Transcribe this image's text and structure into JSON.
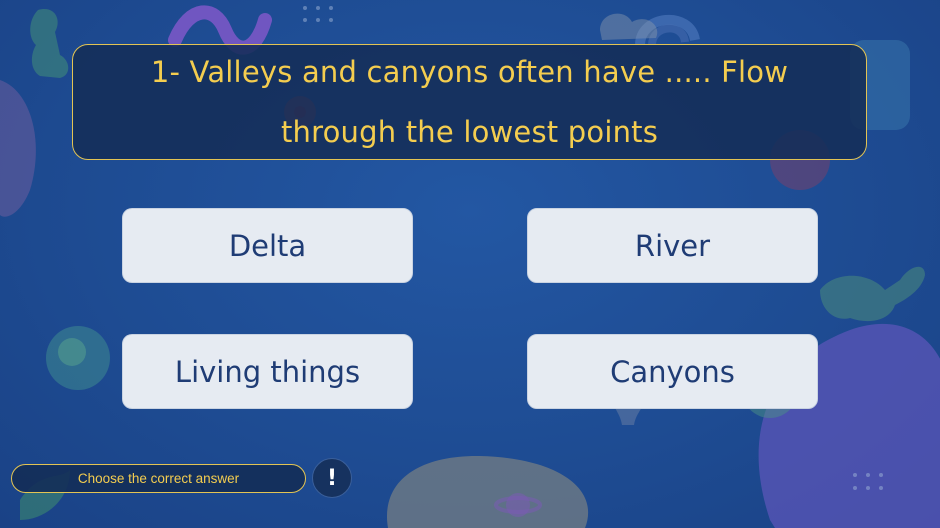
{
  "question": {
    "text": "1- Valleys and canyons often have ..... Flow through the lowest points"
  },
  "answers": [
    {
      "label": "Delta"
    },
    {
      "label": "River"
    },
    {
      "label": "Living things"
    },
    {
      "label": "Canyons"
    }
  ],
  "instruction": {
    "text": "Choose the correct answer"
  },
  "hint": {
    "symbol": "!",
    "icon": "exclamation-icon"
  },
  "colors": {
    "background": "#1f4e96",
    "accent_yellow": "#f4cd4f",
    "answer_box": "#e6ebf2",
    "answer_text": "#1f3c75"
  }
}
